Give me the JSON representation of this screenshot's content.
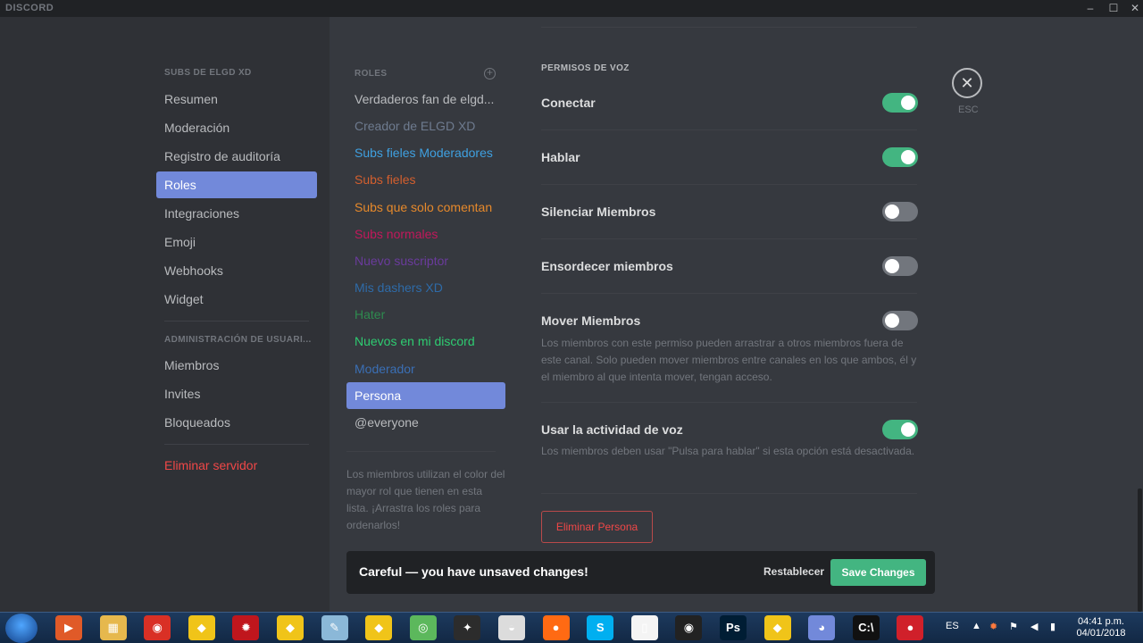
{
  "window": {
    "logo": "DISCORD",
    "minimize_glyph": "–",
    "maximize_glyph": "☐",
    "close_glyph": "✕"
  },
  "sidebar": {
    "server_header": "SUBS DE ELGD XD",
    "items": [
      {
        "label": "Resumen"
      },
      {
        "label": "Moderación"
      },
      {
        "label": "Registro de auditoría"
      },
      {
        "label": "Roles",
        "selected": true
      },
      {
        "label": "Integraciones"
      },
      {
        "label": "Emoji"
      },
      {
        "label": "Webhooks"
      },
      {
        "label": "Widget"
      }
    ],
    "user_admin_header": "ADMINISTRACIÓN DE USUARI...",
    "user_items": [
      {
        "label": "Miembros"
      },
      {
        "label": "Invites"
      },
      {
        "label": "Bloqueados"
      }
    ],
    "delete_server": "Eliminar servidor"
  },
  "roles_panel": {
    "header": "ROLES",
    "add_glyph": "+",
    "roles": [
      {
        "label": "Verdaderos fan de elgd...",
        "color": "#b9bbbe"
      },
      {
        "label": "Creador de ELGD XD",
        "color": "#6e7b8f"
      },
      {
        "label": "Subs fieles Moderadores",
        "color": "#3fa0e0"
      },
      {
        "label": "Subs fieles",
        "color": "#d35f2e"
      },
      {
        "label": "Subs que solo comentan",
        "color": "#e6892b"
      },
      {
        "label": "Subs normales",
        "color": "#c2185b"
      },
      {
        "label": "Nuevo suscriptor",
        "color": "#6a3b9c"
      },
      {
        "label": "Mis dashers XD",
        "color": "#2e6ba8"
      },
      {
        "label": "Hater",
        "color": "#2e8b4f"
      },
      {
        "label": "Nuevos en mi discord",
        "color": "#2ecc71"
      },
      {
        "label": "Moderador",
        "color": "#3a6fb5"
      },
      {
        "label": "Persona",
        "color": "#ffffff",
        "selected": true
      },
      {
        "label": "@everyone",
        "color": "#b9bbbe"
      }
    ],
    "help_text": "Los miembros utilizan el color del mayor rol que tienen en esta lista. ¡Arrastra los roles para ordenarlos!"
  },
  "permissions": {
    "section_header": "PERMISOS DE VOZ",
    "items": [
      {
        "label": "Conectar",
        "enabled": true,
        "description": ""
      },
      {
        "label": "Hablar",
        "enabled": true,
        "description": ""
      },
      {
        "label": "Silenciar Miembros",
        "enabled": false,
        "description": ""
      },
      {
        "label": "Ensordecer miembros",
        "enabled": false,
        "description": ""
      },
      {
        "label": "Mover Miembros",
        "enabled": false,
        "description": "Los miembros con este permiso pueden arrastrar a otros miembros fuera de este canal. Solo pueden mover miembros entre canales en los que ambos, él y el miembro al que intenta mover, tengan acceso."
      },
      {
        "label": "Usar la actividad de voz",
        "enabled": true,
        "description": "Los miembros deben usar \"Pulsa para hablar\" si esta opción está desactivada."
      }
    ],
    "delete_role": "Eliminar Persona"
  },
  "close": {
    "glyph": "✕",
    "label": "ESC"
  },
  "unsaved": {
    "message": "Careful — you have unsaved changes!",
    "reset": "Restablecer",
    "save": "Save Changes"
  },
  "taskbar": {
    "icons": [
      {
        "name": "video-player-icon",
        "glyph": "▶",
        "color": "#e05a28"
      },
      {
        "name": "file-explorer-icon",
        "glyph": "▦",
        "color": "#e6b84d"
      },
      {
        "name": "chrome-icon",
        "glyph": "◉",
        "color": "#d93025"
      },
      {
        "name": "geometry-dash-icon",
        "glyph": "◆",
        "color": "#f0c419"
      },
      {
        "name": "game-app-icon",
        "glyph": "✹",
        "color": "#c0161d"
      },
      {
        "name": "geometry-dash-icon",
        "glyph": "◆",
        "color": "#f0c419"
      },
      {
        "name": "notepad-icon",
        "glyph": "✎",
        "color": "#8bb8d8"
      },
      {
        "name": "geometry-dash-icon",
        "glyph": "◆",
        "color": "#f0c419"
      },
      {
        "name": "media-app-icon",
        "glyph": "◎",
        "color": "#5cb85c"
      },
      {
        "name": "editor-app-icon",
        "glyph": "✦",
        "color": "#2c2c2c"
      },
      {
        "name": "hat-app-icon",
        "glyph": "◒",
        "color": "#dcdcdc"
      },
      {
        "name": "firefox-icon",
        "glyph": "●",
        "color": "#ff6a13"
      },
      {
        "name": "skype-icon",
        "glyph": "S",
        "color": "#00aff0"
      },
      {
        "name": "document-icon",
        "glyph": "▯",
        "color": "#f4f4f4"
      },
      {
        "name": "recorder-icon",
        "glyph": "◉",
        "color": "#222222"
      },
      {
        "name": "photoshop-icon",
        "glyph": "Ps",
        "color": "#001d34"
      },
      {
        "name": "geometry-dash-icon",
        "glyph": "◆",
        "color": "#f0c419"
      },
      {
        "name": "discord-icon",
        "glyph": "◕",
        "color": "#7289da"
      },
      {
        "name": "command-prompt-icon",
        "glyph": "C:\\",
        "color": "#111111"
      },
      {
        "name": "record-app-icon",
        "glyph": "●",
        "color": "#d0202a"
      }
    ],
    "language": "ES",
    "time": "04:41 p.m.",
    "date": "04/01/2018"
  }
}
